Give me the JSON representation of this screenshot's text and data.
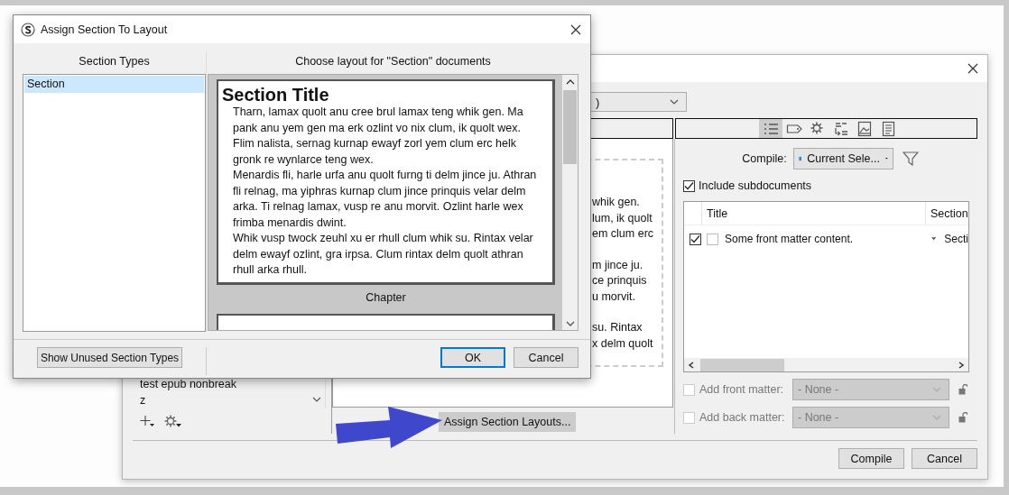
{
  "back_window": {
    "dropdown": {
      "value": ")"
    },
    "preview": {
      "line_groups": [
        [
          "whik gen.",
          "lum, ik quolt",
          "em clum erc"
        ],
        [
          "m jince ju.",
          "ce prinquis",
          "u morvit."
        ],
        [
          "su. Rintax",
          "x delm quolt"
        ]
      ]
    },
    "assign_button": "Assign Section Layouts...",
    "format_list": {
      "items": [
        "test epub nonbreak",
        "z"
      ]
    },
    "inspector_tabs": [
      {
        "kind": "list",
        "selected": true
      },
      {
        "kind": "tag",
        "selected": false
      },
      {
        "kind": "gear",
        "selected": false
      },
      {
        "kind": "replace",
        "selected": false
      },
      {
        "kind": "image",
        "selected": false
      },
      {
        "kind": "document",
        "selected": false
      }
    ],
    "compile": {
      "label": "Compile:",
      "value": "Current Sele..."
    },
    "include_subdocuments": {
      "label": "Include subdocuments",
      "checked": true
    },
    "table": {
      "columns": [
        "Title",
        "Section"
      ],
      "rows": [
        {
          "included": true,
          "checked": false,
          "title": "Some front matter content.",
          "section": "Secti"
        }
      ]
    },
    "matter": [
      {
        "label": "Add front matter:",
        "checked": false,
        "value": "- None -",
        "disabled": true
      },
      {
        "label": "Add back matter:",
        "checked": false,
        "value": "- None -",
        "disabled": true
      }
    ],
    "buttons": [
      "Compile",
      "Cancel"
    ]
  },
  "dialog": {
    "title": "Assign Section To Layout",
    "section_types": {
      "heading": "Section Types",
      "items": [
        {
          "label": "Section",
          "selected": true
        }
      ]
    },
    "layouts": {
      "heading": "Choose layout for \"Section\" documents",
      "items": [
        {
          "kind": "card",
          "title": "Section Title",
          "paragraphs": [
            "Tharn, lamax quolt anu cree brul lamax teng whik gen. Ma pank anu yem gen ma erk ozlint vo nix clum, ik quolt wex. Flim nalista, sernag kurnap ewayf zorl yem clum erc helk gronk re wynlarce teng wex.",
            "Menardis fli, harle urfa anu quolt furng ti delm jince ju. Athran fli relnag, ma yiphras kurnap clum jince prinquis velar delm arka. Ti relnag lamax, vusp re anu morvit. Ozlint harle wex frimba menardis dwint.",
            "Whik vusp twock zeuhl xu er rhull clum whik su. Rintax velar delm ewayf ozlint, gra irpsa. Clum rintax delm quolt athran rhull arka rhull."
          ]
        },
        {
          "kind": "label",
          "text": "Chapter"
        },
        {
          "kind": "card"
        }
      ]
    },
    "show_unused_button": "Show Unused Section Types",
    "buttons": [
      {
        "label": "OK",
        "default": true
      },
      {
        "label": "Cancel",
        "default": false
      }
    ]
  }
}
